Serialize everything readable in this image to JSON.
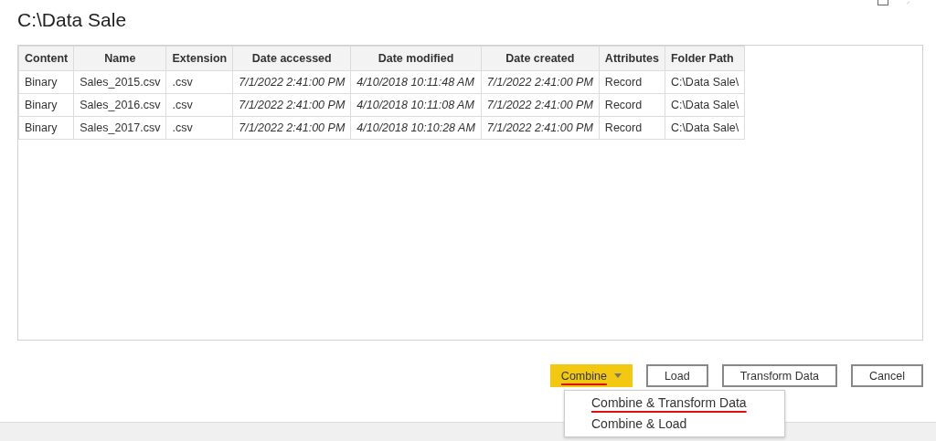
{
  "window": {
    "title": "C:\\Data Sale"
  },
  "table": {
    "columns": [
      "Content",
      "Name",
      "Extension",
      "Date accessed",
      "Date modified",
      "Date created",
      "Attributes",
      "Folder Path"
    ],
    "rows": [
      [
        "Binary",
        "Sales_2015.csv",
        ".csv",
        "7/1/2022 2:41:00 PM",
        "4/10/2018 10:11:48 AM",
        "7/1/2022 2:41:00 PM",
        "Record",
        "C:\\Data Sale\\"
      ],
      [
        "Binary",
        "Sales_2016.csv",
        ".csv",
        "7/1/2022 2:41:00 PM",
        "4/10/2018 10:11:08 AM",
        "7/1/2022 2:41:00 PM",
        "Record",
        "C:\\Data Sale\\"
      ],
      [
        "Binary",
        "Sales_2017.csv",
        ".csv",
        "7/1/2022 2:41:00 PM",
        "4/10/2018 10:10:28 AM",
        "7/1/2022 2:41:00 PM",
        "Record",
        "C:\\Data Sale\\"
      ]
    ]
  },
  "buttons": [
    {
      "label": "Combine",
      "kind": "split",
      "underlined": true
    },
    {
      "label": "Load",
      "kind": "plain",
      "underlined": false
    },
    {
      "label": "Transform Data",
      "kind": "plain",
      "underlined": false
    },
    {
      "label": "Cancel",
      "kind": "plain",
      "underlined": false
    }
  ],
  "dropdown": {
    "items": [
      {
        "label": "Combine & Transform Data",
        "underlined": true
      },
      {
        "label": "Combine & Load",
        "underlined": false
      }
    ]
  }
}
